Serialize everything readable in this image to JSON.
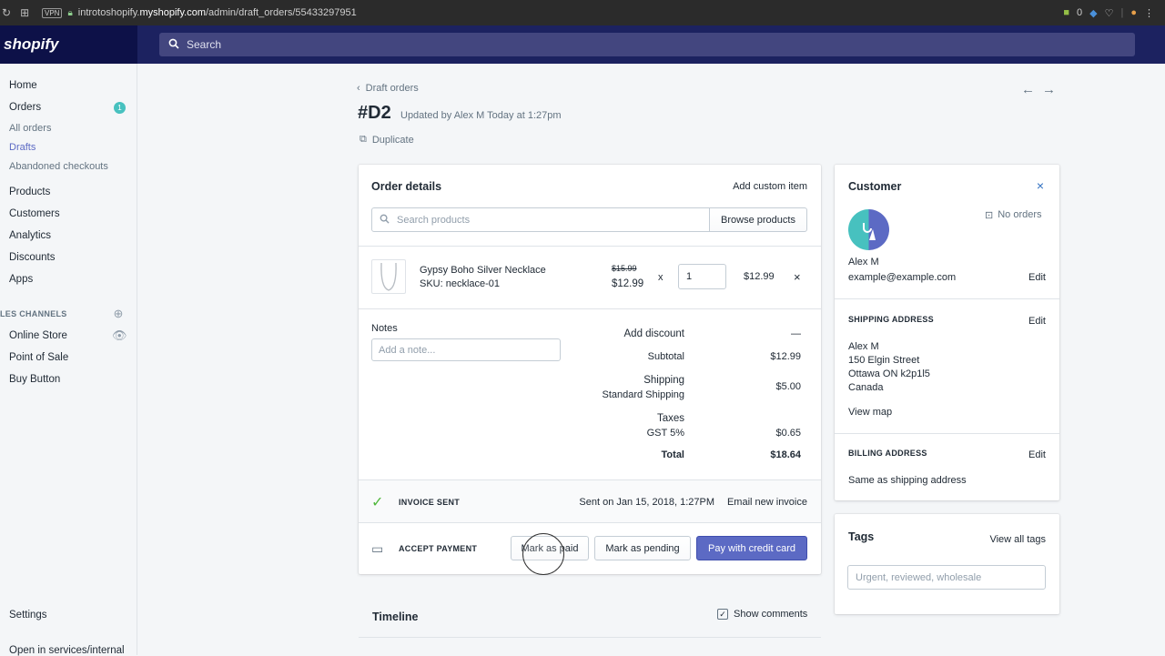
{
  "browser": {
    "url_prefix": "introtoshopify.",
    "url_host": "myshopify.com",
    "url_path": "/admin/draft_orders/55433297951",
    "vpn": "VPN",
    "ext_count": "0"
  },
  "topbar": {
    "logo": "shopify",
    "search_placeholder": "Search"
  },
  "sidebar": {
    "home": "Home",
    "orders": "Orders",
    "orders_badge": "1",
    "all_orders": "All orders",
    "drafts": "Drafts",
    "abandoned": "Abandoned checkouts",
    "products": "Products",
    "customers": "Customers",
    "analytics": "Analytics",
    "discounts": "Discounts",
    "apps": "Apps",
    "channels_label": "LES CHANNELS",
    "online_store": "Online Store",
    "pos": "Point of Sale",
    "buy_button": "Buy Button",
    "settings": "Settings",
    "open_internal": "Open in services/internal"
  },
  "header": {
    "back": "Draft orders",
    "title": "#D2",
    "updated": "Updated by Alex M Today at 1:27pm",
    "duplicate": "Duplicate"
  },
  "order": {
    "title": "Order details",
    "add_custom": "Add custom item",
    "search_placeholder": "Search products",
    "browse": "Browse products",
    "item": {
      "name": "Gypsy Boho Silver Necklace",
      "sku": "SKU: necklace-01",
      "orig_price": "$15.99",
      "price": "$12.99",
      "times": "x",
      "qty": "1",
      "total": "$12.99",
      "remove": "×"
    },
    "notes_label": "Notes",
    "notes_placeholder": "Add a note...",
    "add_discount": "Add discount",
    "discount_value": "—",
    "subtotal_label": "Subtotal",
    "subtotal": "$12.99",
    "shipping_label": "Shipping",
    "shipping_method": "Standard Shipping",
    "shipping": "$5.00",
    "taxes_label": "Taxes",
    "tax_name": "GST 5%",
    "tax": "$0.65",
    "total_label": "Total",
    "total": "$18.64",
    "invoice_sent": "INVOICE SENT",
    "sent_on": "Sent on Jan 15, 2018, 1:27PM",
    "email_invoice": "Email new invoice",
    "accept_payment": "ACCEPT PAYMENT",
    "mark_paid": "Mark as paid",
    "mark_pending": "Mark as pending",
    "pay_card": "Pay with credit card"
  },
  "timeline": {
    "title": "Timeline",
    "show_comments": "Show comments"
  },
  "customer": {
    "title": "Customer",
    "close": "×",
    "no_orders": "No orders",
    "name": "Alex M",
    "email": "example@example.com",
    "edit": "Edit",
    "shipping_title": "SHIPPING ADDRESS",
    "ship_name": "Alex M",
    "ship_street": "150 Elgin Street",
    "ship_city": "Ottawa ON k2p1l5",
    "ship_country": "Canada",
    "view_map": "View map",
    "billing_title": "BILLING ADDRESS",
    "billing_same": "Same as shipping address"
  },
  "tags": {
    "title": "Tags",
    "view_all": "View all tags",
    "placeholder": "Urgent, reviewed, wholesale"
  },
  "colors": {
    "accent": "#5c6ac4",
    "link": "#2e6fc0",
    "topbar": "#1c2260",
    "success": "#50b83c"
  }
}
